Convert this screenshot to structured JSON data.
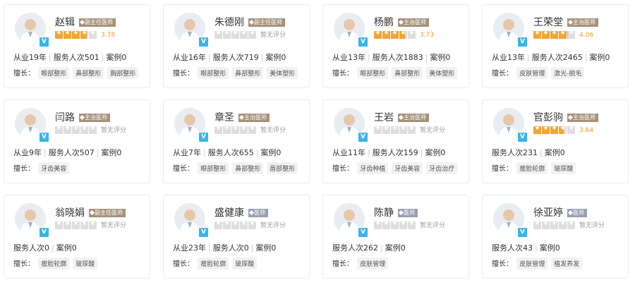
{
  "specialties_label": "擅长：",
  "accent_colors": {
    "star": "#f3a432",
    "score_text": "#f19d2b",
    "verified_badge": "#3ab4ea",
    "title_badge": "#a6917a",
    "title_badge_doctor": "#9c9fb4"
  },
  "doctors": [
    {
      "name": "赵辑",
      "title": "副主任医师",
      "rating": 3.78,
      "rating_text": "3.78",
      "stats": [
        "从业19年",
        "服务人次501",
        "案例0"
      ],
      "specialties": [
        "眼部整形",
        "鼻部整形",
        "胸部整形"
      ]
    },
    {
      "name": "朱德刚",
      "title": "副主任医师",
      "rating": 0,
      "rating_text": "暂无评分",
      "stats": [
        "从业16年",
        "服务人次719",
        "案例0"
      ],
      "specialties": [
        "眼部整形",
        "鼻部整形",
        "美体塑形"
      ]
    },
    {
      "name": "杨鹏",
      "title": "主治医师",
      "rating": 3.73,
      "rating_text": "3.73",
      "stats": [
        "从业13年",
        "服务人次1883",
        "案例0"
      ],
      "specialties": [
        "眼部整形",
        "鼻部整形",
        "美体塑形"
      ]
    },
    {
      "name": "王荣堂",
      "title": "主治医师",
      "rating": 4.06,
      "rating_text": "4.06",
      "stats": [
        "从业13年",
        "服务人次2465",
        "案例0"
      ],
      "specialties": [
        "皮肤管理",
        "激光-脱毛"
      ]
    },
    {
      "name": "闫路",
      "title": "主治医师",
      "rating": 0,
      "rating_text": "暂无评分",
      "stats": [
        "从业9年",
        "服务人次507",
        "案例0"
      ],
      "specialties": [
        "牙齿美容"
      ]
    },
    {
      "name": "章圣",
      "title": "主治医师",
      "rating": 0,
      "rating_text": "暂无评分",
      "stats": [
        "从业7年",
        "服务人次655",
        "案例0"
      ],
      "specialties": [
        "眼部整形",
        "鼻部整形",
        "唇部整形"
      ]
    },
    {
      "name": "王岩",
      "title": "主治医师",
      "rating": 0,
      "rating_text": "暂无评分",
      "stats": [
        "从业11年",
        "服务人次159",
        "案例0"
      ],
      "specialties": [
        "牙齿种植",
        "牙齿美容",
        "牙齿治疗"
      ]
    },
    {
      "name": "官彭驹",
      "title": "主治医师",
      "rating": 3.64,
      "rating_text": "3.64",
      "stats": [
        "服务人次231",
        "案例0"
      ],
      "specialties": [
        "瘦脸轮廓",
        "玻尿酸"
      ]
    },
    {
      "name": "翁晓娟",
      "title": "副主任医师",
      "rating": 0,
      "rating_text": "暂无评分",
      "stats": [
        "服务人次0",
        "案例0"
      ],
      "specialties": [
        "瘦脸轮廓",
        "玻尿酸"
      ]
    },
    {
      "name": "盛健康",
      "title": "医师",
      "rating": 0,
      "rating_text": "暂无评分",
      "stats": [
        "从业23年",
        "服务人次0",
        "案例0"
      ],
      "specialties": [
        "瘦脸轮廓",
        "玻尿酸"
      ]
    },
    {
      "name": "陈静",
      "title": "医师",
      "rating": 0,
      "rating_text": "暂无评分",
      "stats": [
        "服务人次262",
        "案例0"
      ],
      "specialties": [
        "皮肤管理"
      ]
    },
    {
      "name": "徐亚婷",
      "title": "医师",
      "rating": 0,
      "rating_text": "暂无评分",
      "stats": [
        "服务人次43",
        "案例0"
      ],
      "specialties": [
        "皮肤管理",
        "植发养发"
      ]
    }
  ]
}
